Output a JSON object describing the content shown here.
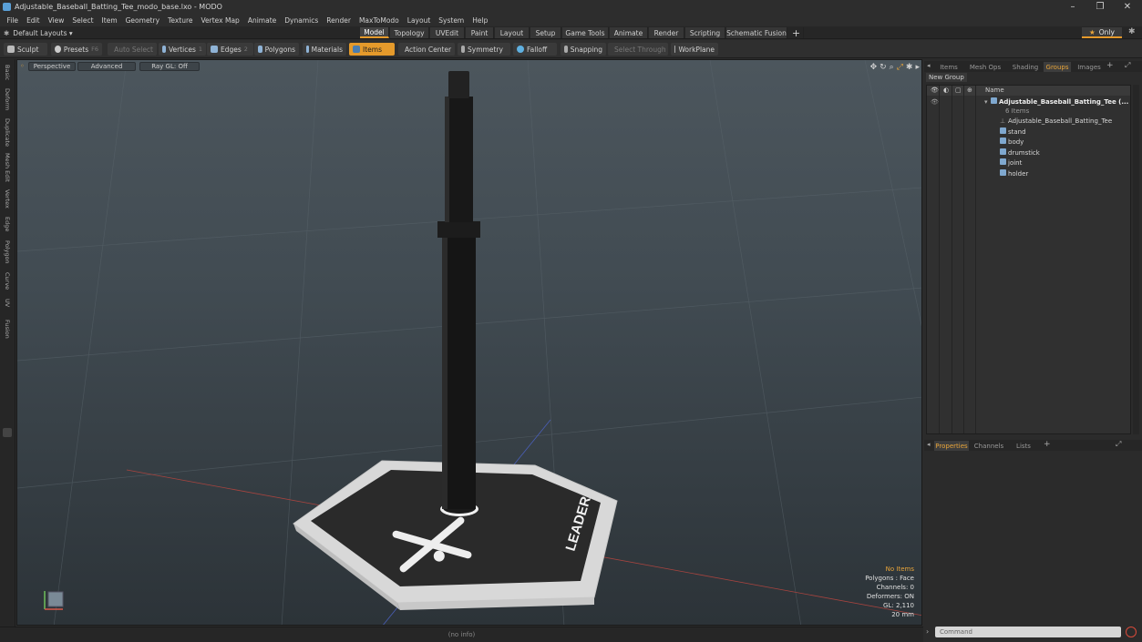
{
  "window": {
    "title": "Adjustable_Baseball_Batting_Tee_modo_base.lxo - MODO",
    "minimize": "–",
    "maximize": "❐",
    "close": "✕"
  },
  "menubar": [
    "File",
    "Edit",
    "View",
    "Select",
    "Item",
    "Geometry",
    "Texture",
    "Vertex Map",
    "Animate",
    "Dynamics",
    "Render",
    "MaxToModo",
    "Layout",
    "System",
    "Help"
  ],
  "layouts": {
    "selector": "Default Layouts ▾",
    "tabs": [
      "Model",
      "Topology",
      "UVEdit",
      "Paint",
      "Layout",
      "Setup",
      "Game Tools",
      "Animate",
      "Render",
      "Scripting",
      "Schematic Fusion"
    ],
    "active_tab": "Model",
    "add": "+",
    "only": "Only",
    "star": "★"
  },
  "toolbar": {
    "sculpt": "Sculpt",
    "presets": "Presets",
    "presets_key": "F6",
    "auto_select": "Auto Select",
    "vertices": "Vertices",
    "vertices_key": "1",
    "edges": "Edges",
    "edges_key": "2",
    "polygons": "Polygons",
    "materials": "Materials",
    "items": "Items",
    "action_center": "Action Center",
    "symmetry": "Symmetry",
    "falloff": "Falloff",
    "snapping": "Snapping",
    "select_through": "Select Through",
    "workplane": "WorkPlane"
  },
  "left_tabs": [
    "Basic",
    "Deform",
    "Duplicate",
    "Mesh Edit",
    "Vertex",
    "Edge",
    "Polygon",
    "Curve",
    "UV",
    "Fusion"
  ],
  "viewport": {
    "view": "Perspective",
    "shading": "Advanced",
    "raygl": "Ray GL: Off",
    "tee_logo_text": "LEADER",
    "info": {
      "selection": "No Items",
      "polygons": "Polygons : Face",
      "channels": "Channels: 0",
      "deformers": "Deformers: ON",
      "gl": "GL: 2,110",
      "scale": "20 mm"
    }
  },
  "status": "(no info)",
  "right_panel": {
    "top_tabs": [
      "Items",
      "Mesh Ops",
      "Shading",
      "Groups",
      "Images"
    ],
    "active_top_tab": "Groups",
    "new_group": "New Group",
    "column_name": "Name",
    "group": {
      "name": "Adjustable_Baseball_Batting_Tee",
      "suffix": "(...",
      "count": "6 Items"
    },
    "items": [
      "Adjustable_Baseball_Batting_Tee",
      "stand",
      "body",
      "drumstick",
      "joint",
      "holder"
    ],
    "bottom_tabs": [
      "Properties",
      "Channels",
      "Lists"
    ],
    "active_bottom_tab": "Properties",
    "command_placeholder": "Command"
  },
  "colors": {
    "accent": "#e59a2b",
    "info_highlight": "#e9a53a"
  }
}
